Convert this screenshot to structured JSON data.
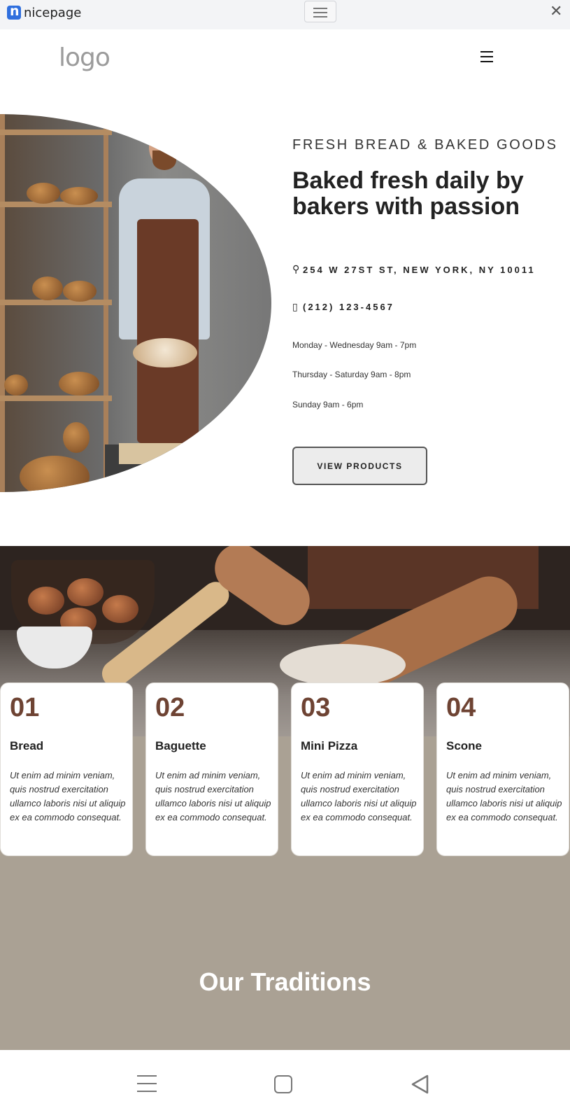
{
  "browser": {
    "brand_name": "nicepage",
    "brand_color": "#2f6fde"
  },
  "header": {
    "logo_text": "logo"
  },
  "hero": {
    "kicker": "FRESH BREAD & BAKED GOODS",
    "title": "Baked fresh daily by bakers with passion",
    "address": "254 W 27ST ST, NEW YORK, NY 10011",
    "phone": "(212) 123-4567",
    "hours": [
      "Monday - Wednesday 9am - 7pm",
      "Thursday - Saturday 9am - 8pm",
      "Sunday 9am - 6pm"
    ],
    "button_label": "VIEW PRODUCTS"
  },
  "products": {
    "accent_color": "#6e4333",
    "background_color": "#aaa194",
    "items": [
      {
        "number": "01",
        "title": "Bread",
        "text": "Ut enim ad minim veniam, quis nostrud exercitation ullamco laboris nisi ut aliquip ex ea commodo consequat."
      },
      {
        "number": "02",
        "title": "Baguette",
        "text": "Ut enim ad minim veniam, quis nostrud exercitation ullamco laboris nisi ut aliquip ex ea commodo consequat."
      },
      {
        "number": "03",
        "title": "Mini Pizza",
        "text": "Ut enim ad minim veniam, quis nostrud exercitation ullamco laboris nisi ut aliquip ex ea commodo consequat."
      },
      {
        "number": "04",
        "title": "Scone",
        "text": "Ut enim ad minim veniam, quis nostrud exercitation ullamco laboris nisi ut aliquip ex ea commodo consequat."
      }
    ]
  },
  "traditions": {
    "heading": "Our Traditions"
  },
  "icons": {
    "top_menu": "menu-icon",
    "top_close": "close-icon",
    "site_menu": "hamburger-icon",
    "address": "map-pin-icon",
    "phone": "phone-icon",
    "nav_menu": "recent-apps-icon",
    "nav_home": "home-square-icon",
    "nav_back": "back-triangle-icon"
  }
}
